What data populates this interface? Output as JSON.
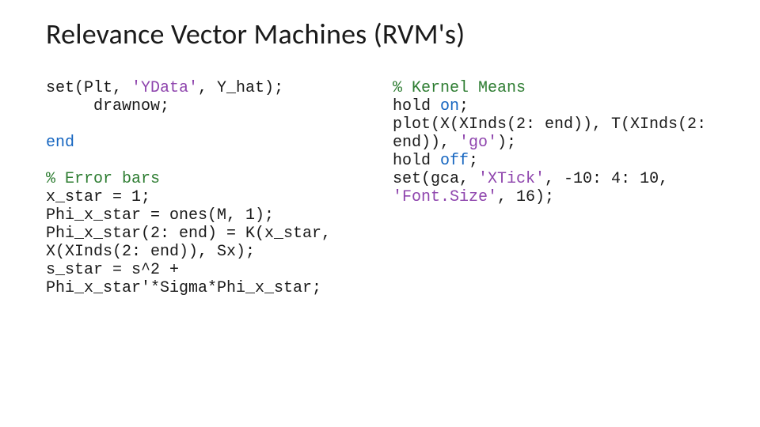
{
  "title": "Relevance Vector Machines (RVM's)",
  "left": {
    "l1a": "set(Plt, ",
    "l1b": "'YData'",
    "l1c": ", Y_hat);",
    "l2": "     drawnow;",
    "blank1": "",
    "l3": "end",
    "blank2": "",
    "c1": "% Error bars",
    "l4": "x_star = 1;",
    "l5": "Phi_x_star = ones(M, 1);",
    "l6": "Phi_x_star(2: end) = K(x_star, X(XInds(2: end)), Sx);",
    "l7": "s_star = s^2 + Phi_x_star'*Sigma*Phi_x_star;"
  },
  "right": {
    "c1": "% Kernel Means",
    "l1a": "hold ",
    "l1b": "on",
    "l1c": ";",
    "l2a": "plot(X(XInds(2: end)), T(XInds(2: end)), ",
    "l2b": "'go'",
    "l2c": ");",
    "l3a": "hold ",
    "l3b": "off",
    "l3c": ";",
    "l4a": "set(gca, ",
    "l4b": "'XTick'",
    "l4c": ", -10: 4: 10, ",
    "l4d": "'Font.Size'",
    "l4e": ", 16);"
  }
}
